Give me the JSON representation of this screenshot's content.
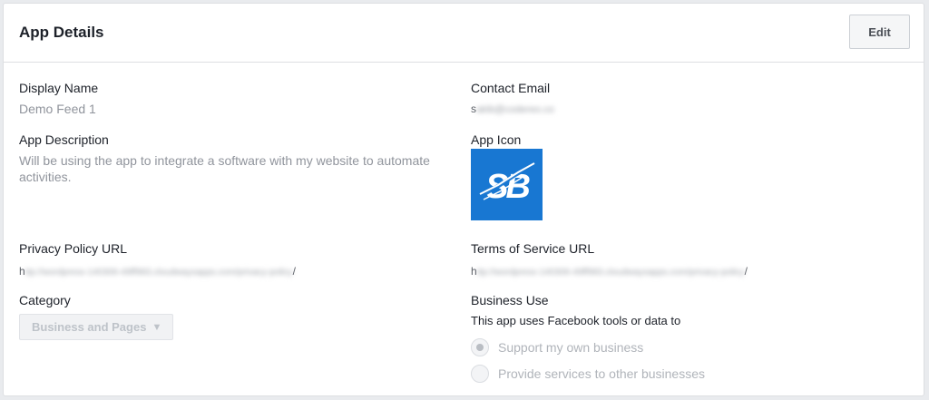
{
  "card": {
    "title": "App Details",
    "edit_label": "Edit"
  },
  "left": {
    "display_name_label": "Display Name",
    "display_name_value": "Demo Feed 1",
    "description_label": "App Description",
    "description_value": "Will be using the app to integrate a software with my website to automate activities.",
    "privacy_label": "Privacy Policy URL",
    "privacy_prefix": "h",
    "privacy_blurred": "ttp://wordpress-140306-49ff983.cloudwaysapps.com/privacy-policy",
    "privacy_suffix": "/",
    "category_label": "Category",
    "category_value": "Business and Pages"
  },
  "right": {
    "contact_label": "Contact Email",
    "contact_prefix": "s",
    "contact_blurred": "akib@codereo.co",
    "icon_label": "App Icon",
    "icon_text": "SB",
    "icon_color": "#1877d2",
    "terms_label": "Terms of Service URL",
    "terms_prefix": "h",
    "terms_blurred": "ttp://wordpress-140306-49ff983.cloudwaysapps.com/privacy-policy",
    "terms_suffix": "/",
    "business_use_label": "Business Use",
    "business_use_desc": "This app uses Facebook tools or data to",
    "options": [
      {
        "label": "Support my own business",
        "selected": true
      },
      {
        "label": "Provide services to other businesses",
        "selected": false
      }
    ]
  }
}
